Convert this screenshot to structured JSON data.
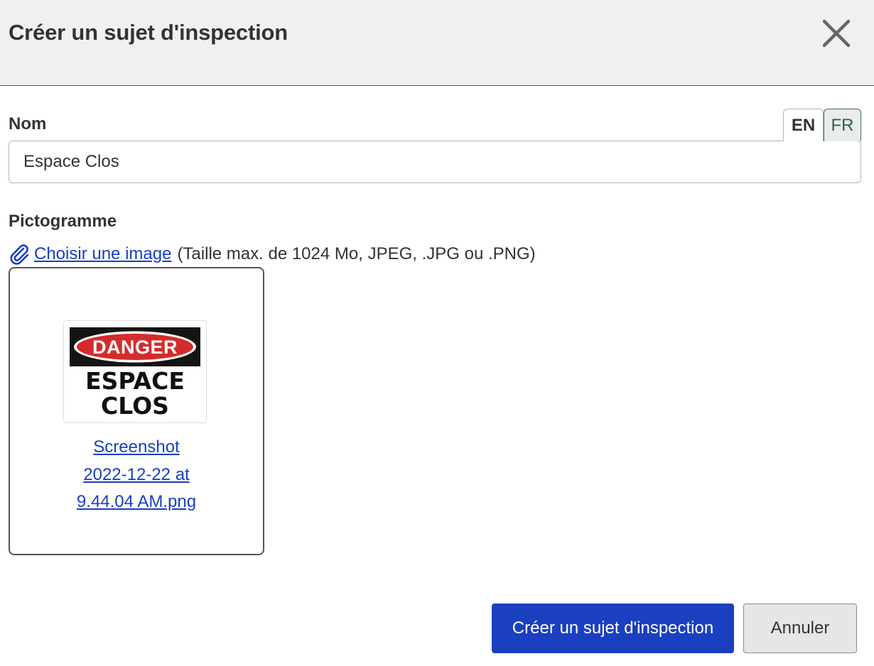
{
  "dialog": {
    "title": "Créer un sujet d'inspection",
    "close_icon": "close-icon"
  },
  "name_field": {
    "label": "Nom",
    "value": "Espace Clos",
    "languages": [
      {
        "code": "EN",
        "active": true
      },
      {
        "code": "FR",
        "active": false
      }
    ]
  },
  "pictogram": {
    "label": "Pictogramme",
    "upload_icon": "paperclip-icon",
    "upload_link": "Choisir une image",
    "upload_hint": "(Taille max. de 1024 Mo, JPEG, .JPG ou .PNG)",
    "image": {
      "sign_header": "DANGER",
      "sign_line1": "ESPACE",
      "sign_line2": "CLOS"
    },
    "file_name_lines": [
      "Screenshot",
      "2022-12-22 at",
      "9.44.04 AM.png"
    ]
  },
  "actions": {
    "submit_label": "Créer un sujet d'inspection",
    "cancel_label": "Annuler"
  },
  "colors": {
    "primary": "#1a3fc0",
    "link": "#1a3fc0",
    "header_bg": "#f0f0f0",
    "fr_tab": "#2f5d50",
    "danger_red": "#d42c2c"
  }
}
